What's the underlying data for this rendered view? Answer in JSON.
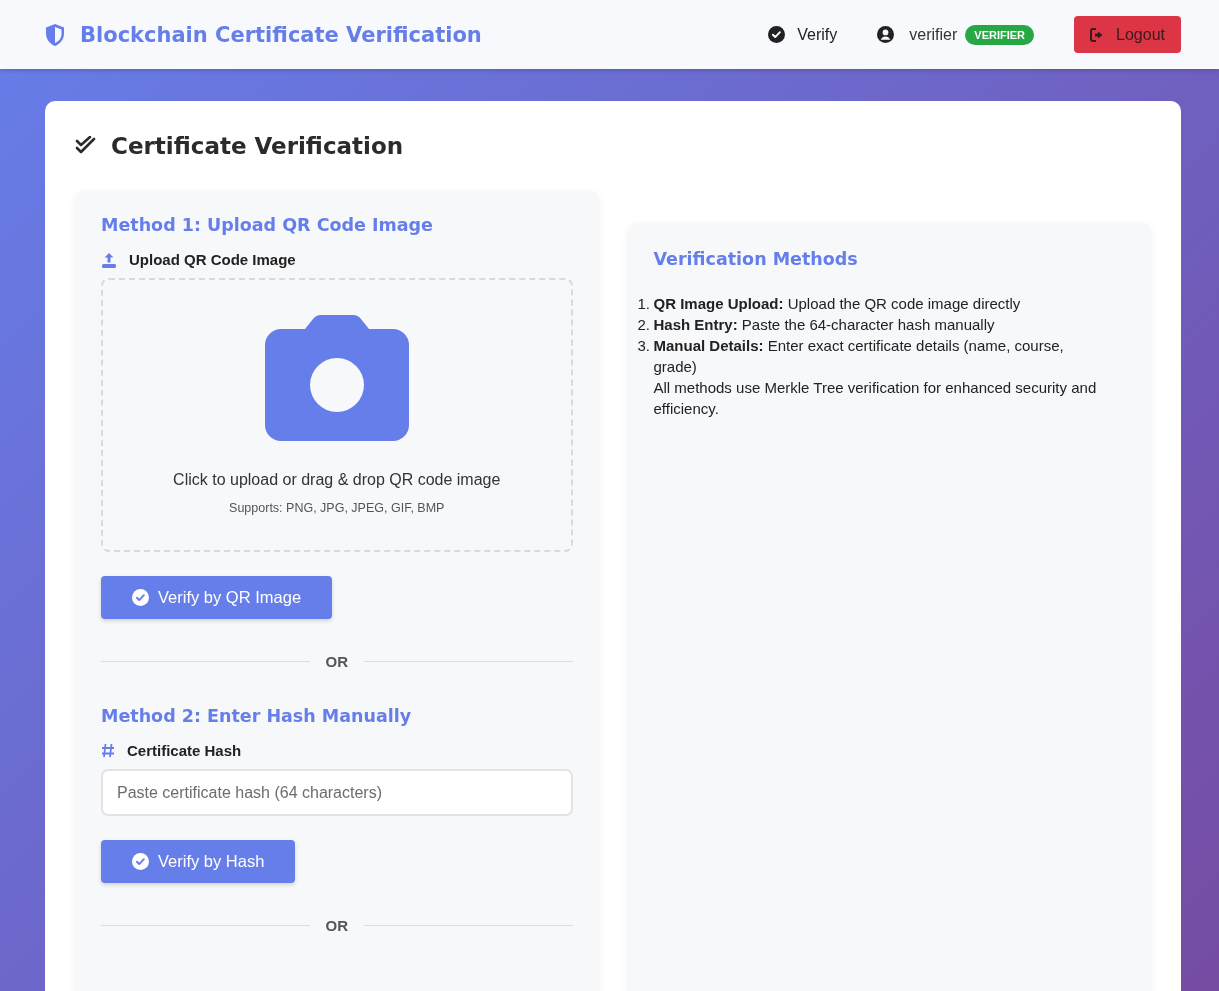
{
  "navbar": {
    "brand": "Blockchain Certificate Verification",
    "links": [
      {
        "label": "Verify",
        "selected": true
      }
    ],
    "user": {
      "name": "verifier",
      "role_badge": "VERIFIER"
    },
    "logout": "Logout"
  },
  "page": {
    "title": "Certificate Verification"
  },
  "methods": [
    {
      "kind": "upload",
      "heading": "Method 1: Upload QR Code Image",
      "label": "Upload QR Code Image",
      "drop_text": "Click to upload or drag & drop QR code image",
      "drop_hint": "Supports: PNG, JPG, JPEG, GIF, BMP",
      "button": "Verify by QR Image",
      "separator": "OR"
    },
    {
      "kind": "hash",
      "heading": "Method 2: Enter Hash Manually",
      "label": "Certificate Hash",
      "placeholder": "Paste certificate hash (64 characters)",
      "button": "Verify by Hash",
      "separator": "OR"
    }
  ],
  "info": {
    "heading": "Verification Methods",
    "items": [
      {
        "number": "1.",
        "text": "**QR Image Upload:** Upload the QR code image directly"
      },
      {
        "number": "2.",
        "text": "**Hash Entry:** Paste the 64-character hash manually"
      },
      {
        "number": "3.",
        "text": "**Manual Details:** Enter exact certificate details (name, course, grade)"
      }
    ],
    "note": "All methods use Merkle Tree verification for enhanced security and efficiency."
  }
}
